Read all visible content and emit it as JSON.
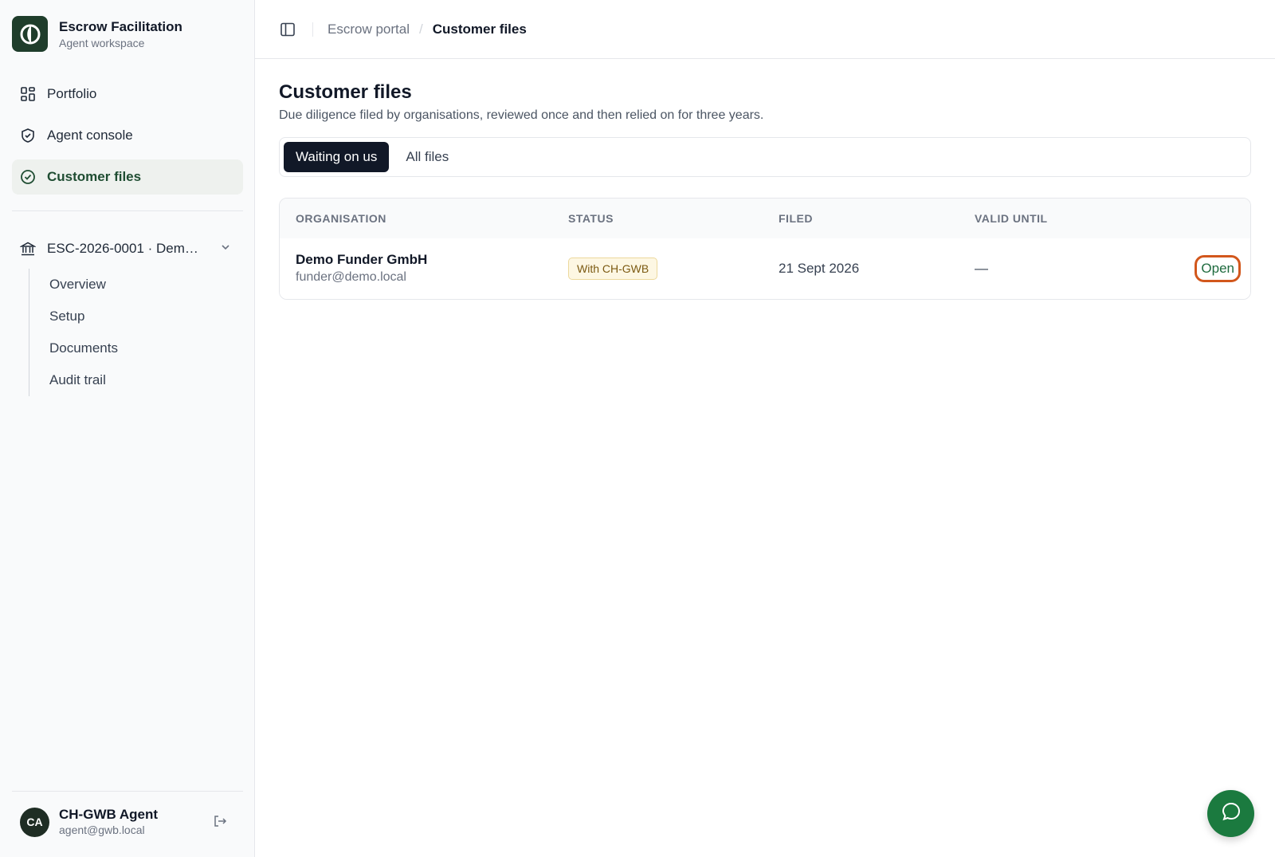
{
  "brand": {
    "title": "Escrow Facilitation",
    "subtitle": "Agent workspace",
    "icon": "logo-icon"
  },
  "nav": {
    "items": [
      {
        "label": "Portfolio",
        "icon": "grid-icon"
      },
      {
        "label": "Agent console",
        "icon": "shield-icon"
      },
      {
        "label": "Customer files",
        "icon": "check-circle-icon",
        "active": true
      }
    ]
  },
  "escrow": {
    "label": "ESC-2026-0001 · Dem…",
    "icon": "bank-icon",
    "subitems": [
      "Overview",
      "Setup",
      "Documents",
      "Audit trail"
    ]
  },
  "user": {
    "initials": "CA",
    "name": "CH-GWB Agent",
    "email": "agent@gwb.local"
  },
  "breadcrumb": {
    "parent": "Escrow portal",
    "separator": "/",
    "current": "Customer files"
  },
  "page": {
    "title": "Customer files",
    "description": "Due diligence filed by organisations, reviewed once and then relied on for three years."
  },
  "tabs": [
    {
      "label": "Waiting on us",
      "active": true
    },
    {
      "label": "All files",
      "active": false
    }
  ],
  "table": {
    "headers": [
      "ORGANISATION",
      "STATUS",
      "FILED",
      "VALID UNTIL"
    ],
    "rows": [
      {
        "org_name": "Demo Funder GmbH",
        "org_email": "funder@demo.local",
        "status": "With CH-GWB",
        "filed": "21 Sept 2026",
        "valid_until": "—",
        "action": "Open"
      }
    ]
  },
  "colors": {
    "accent": "#1f4d32",
    "highlight": "#d2571c",
    "fab": "#1b7a3f"
  }
}
